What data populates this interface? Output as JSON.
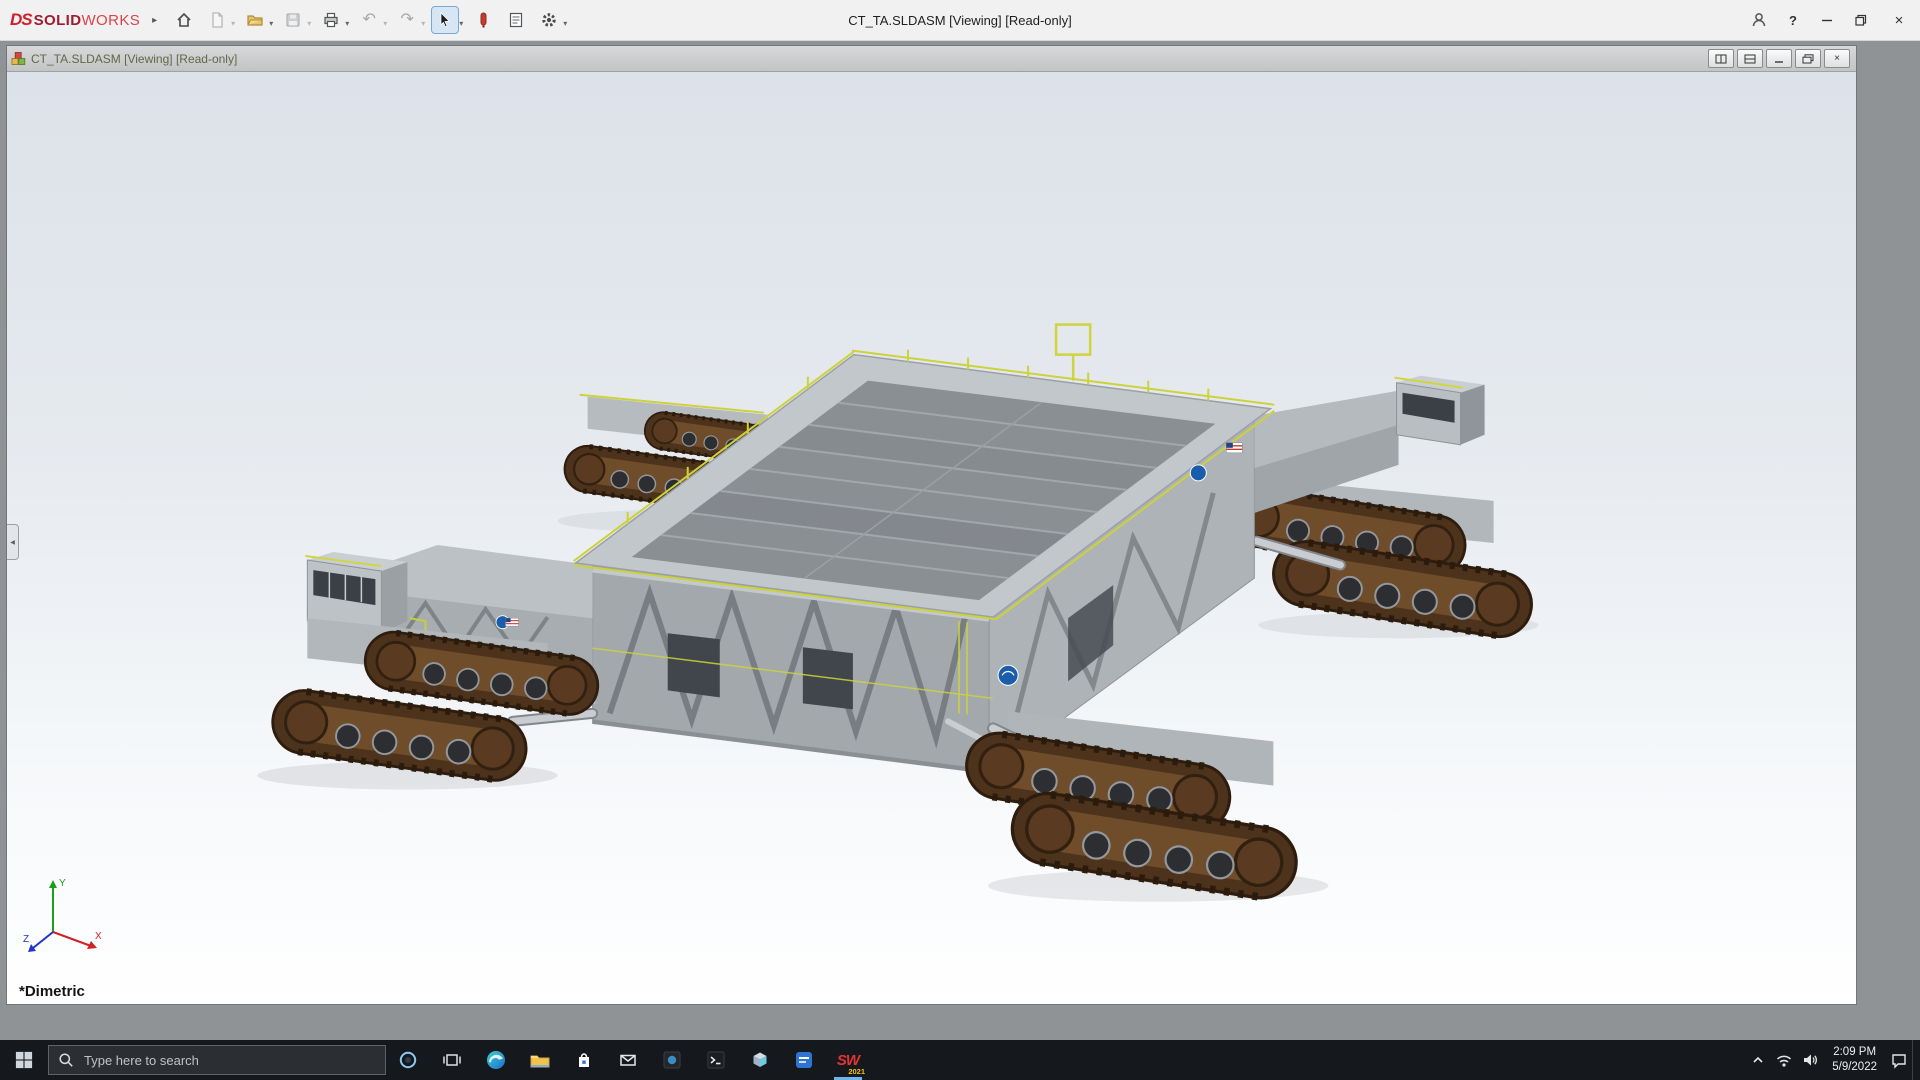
{
  "app": {
    "brand": {
      "prefix": "DS",
      "bold": "SOLID",
      "light": "WORKS"
    },
    "menu_arrow": "▸",
    "title": "CT_TA.SLDASM [Viewing] [Read-only]"
  },
  "glyphs": {
    "caret": "▾",
    "undo": "↶",
    "redo": "↷",
    "help": "?",
    "close": "×",
    "splitter": "◀"
  },
  "doc": {
    "title": "CT_TA.SLDASM [Viewing] [Read-only]"
  },
  "viewport": {
    "view_name": "*Dimetric",
    "triad": {
      "x": "X",
      "y": "Y",
      "z": "Z"
    }
  },
  "taskbar": {
    "search_placeholder": "Type here to search",
    "clock": {
      "time": "2:09 PM",
      "date": "5/9/2022"
    },
    "solidworks": {
      "letters": "SW",
      "year": "2021"
    }
  },
  "colors": {
    "brand_red": "#d01e2f",
    "nasa_blue": "#1a5dab",
    "track_brown": "#4d321c",
    "taskbar_bg": "#15181c"
  }
}
